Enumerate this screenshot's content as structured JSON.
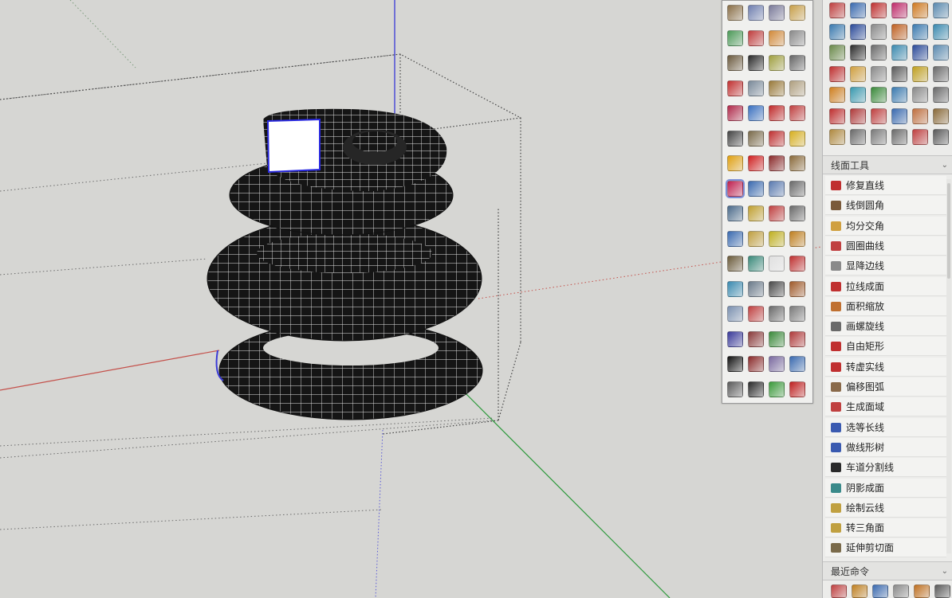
{
  "viewport": {
    "axis_colors": {
      "blue": "#3a3ad6",
      "red": "#c4504a",
      "green": "#2e9a3c"
    },
    "model_color": "#111111",
    "wire_color": "#ffffff",
    "bounding_box_color": "#555555"
  },
  "toolbar_palette": {
    "icon_colors": [
      [
        "#8a6f47",
        "#6f7fb0",
        "#7a7a9a",
        "#c8a04a"
      ],
      [
        "#4c9a58",
        "#c03d3d",
        "#d28a3a",
        "#8a8a8a"
      ],
      [
        "#6b5a3e",
        "#2a2a2a",
        "#a0a040",
        "#666666"
      ],
      [
        "#c23030",
        "#7a8a9a",
        "#9a7a3a",
        "#b0a080"
      ],
      [
        "#b02a4a",
        "#3a70c0",
        "#c02a2a",
        "#c04040"
      ],
      [
        "#444444",
        "#7a6a4a",
        "#c03030",
        "#d8b020"
      ],
      [
        "#e0a010",
        "#d02020",
        "#8a2a2a",
        "#8a6a3a"
      ],
      [
        "#c02050",
        "#3a6ab0",
        "#5a7ab0",
        "#6a6a6a"
      ],
      [
        "#4a6a8a",
        "#c0a030",
        "#c04040",
        "#6a6a6a"
      ],
      [
        "#3a6ab0",
        "#c0a040",
        "#c0b020",
        "#c08020"
      ],
      [
        "#6a5a3a",
        "#3a8a7a",
        "#e0e0e0",
        "#c03030"
      ],
      [
        "#3a8ab0",
        "#6a7a8a",
        "#4a4a4a",
        "#a05a2a"
      ],
      [
        "#7a90b0",
        "#c04040",
        "#6a6a6a",
        "#7a7a7a"
      ],
      [
        "#3a3a9a",
        "#8a3a3a",
        "#3a8a3a",
        "#b03a3a"
      ],
      [
        "#111111",
        "#8a2a2a",
        "#7a6aa0",
        "#3a6ab0"
      ],
      [
        "#5a5a5a",
        "#2a2a2a",
        "#3a9a3a",
        "#c02020"
      ]
    ],
    "active_icon": "paint-tool-icon"
  },
  "tray": {
    "top_icon_colors": [
      [
        "#c04040",
        "#3a6ab0",
        "#c03030",
        "#c02a6a",
        "#d07a20",
        "#5a8ab0"
      ],
      [
        "#3a7ab0",
        "#2a4a9a",
        "#8a8a8a",
        "#c06020",
        "#3a7ab0",
        "#3a8ab0"
      ],
      [
        "#6a8a4a",
        "#2a2a2a",
        "#6a6a6a",
        "#3a8ab0",
        "#2a4a9a",
        "#5a8ab0"
      ],
      [
        "#c03030",
        "#d0a040",
        "#8a8a8a",
        "#5a5a5a",
        "#c0a020",
        "#6a6a6a"
      ],
      [
        "#d08020",
        "#3a9ab0",
        "#3a8a3a",
        "#3a7ab0",
        "#8a8a8a",
        "#6a6a6a"
      ],
      [
        "#c03030",
        "#b03a3a",
        "#c04040",
        "#3a6ab0",
        "#c07040",
        "#8a6a3a"
      ],
      [
        "#b08a40",
        "#6a6a6a",
        "#7a7a7a",
        "#6a6a6a",
        "#c04040",
        "#5a5a5a"
      ]
    ],
    "section1": {
      "title": "线面工具",
      "chevron": "⌄"
    },
    "tools": [
      {
        "label": "修复直线",
        "color": "#c03030"
      },
      {
        "label": "线倒圆角",
        "color": "#7a5a3a"
      },
      {
        "label": "均分交角",
        "color": "#d0a040"
      },
      {
        "label": "圆圈曲线",
        "color": "#c04040"
      },
      {
        "label": "显降边线",
        "color": "#8a8a8a"
      },
      {
        "label": "拉线成面",
        "color": "#c03030"
      },
      {
        "label": "面积缩放",
        "color": "#c07030"
      },
      {
        "label": "画螺旋线",
        "color": "#6a6a6a"
      },
      {
        "label": "自由矩形",
        "color": "#c03030"
      },
      {
        "label": "转虚实线",
        "color": "#c03030"
      },
      {
        "label": "偏移图弧",
        "color": "#8a6a4a"
      },
      {
        "label": "生成面域",
        "color": "#c04040"
      },
      {
        "label": "选等长线",
        "color": "#3a5ab0"
      },
      {
        "label": "做线形树",
        "color": "#3a5ab0"
      },
      {
        "label": "车道分割线",
        "color": "#2a2a2a"
      },
      {
        "label": "阴影成面",
        "color": "#3a8a8a"
      },
      {
        "label": "绘制云线",
        "color": "#c0a040"
      },
      {
        "label": "转三角面",
        "color": "#c0a040"
      },
      {
        "label": "延伸剪切面",
        "color": "#7a6a4a"
      }
    ],
    "section2": {
      "title": "最近命令",
      "chevron": "⌄"
    },
    "recent_icon_colors": [
      "#c04040",
      "#c08020",
      "#3a6ab0",
      "#8a8a8a",
      "#c07020",
      "#5a5a5a"
    ]
  }
}
